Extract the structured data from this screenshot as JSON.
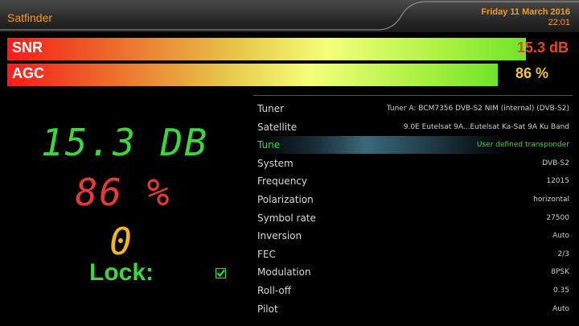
{
  "header": {
    "title": "Satfinder",
    "date": "Friday 11 March 2016",
    "time": "22:01"
  },
  "bars": {
    "snr": {
      "label": "SNR",
      "value_text": "15.3 dB",
      "level_fraction": 0.92
    },
    "agc": {
      "label": "AGC",
      "value_text": "86 %",
      "level_fraction": 0.87
    }
  },
  "readouts": {
    "snr": "15.3 DB",
    "agc": "86 %",
    "ber": "0",
    "lock_label": "Lock:",
    "lock_checked": true
  },
  "info_rows": [
    {
      "label": "Tuner",
      "value": "Tuner A: BCM7356 DVB-S2 NIM (internal) (DVB-S2)"
    },
    {
      "label": "Satellite",
      "value": "9.0E Eutelsat 9A...Eutelsat Ka-Sat 9A Ku Band"
    },
    {
      "label": "Tune",
      "value": "User defined transponder",
      "selected": true
    },
    {
      "label": "System",
      "value": "DVB-S2"
    },
    {
      "label": "Frequency",
      "value": "12015"
    },
    {
      "label": "Polarization",
      "value": "horizontal"
    },
    {
      "label": "Symbol rate",
      "value": "27500"
    },
    {
      "label": "Inversion",
      "value": "Auto"
    },
    {
      "label": "FEC",
      "value": "2/3"
    },
    {
      "label": "Modulation",
      "value": "8PSK"
    },
    {
      "label": "Roll-off",
      "value": "0.35"
    },
    {
      "label": "Pilot",
      "value": "Auto"
    }
  ],
  "colors": {
    "accent_orange": "#f39b1e",
    "lock_green": "#3ad83a",
    "agc_red": "#e83a32",
    "ber_yellow": "#f2b71c"
  }
}
